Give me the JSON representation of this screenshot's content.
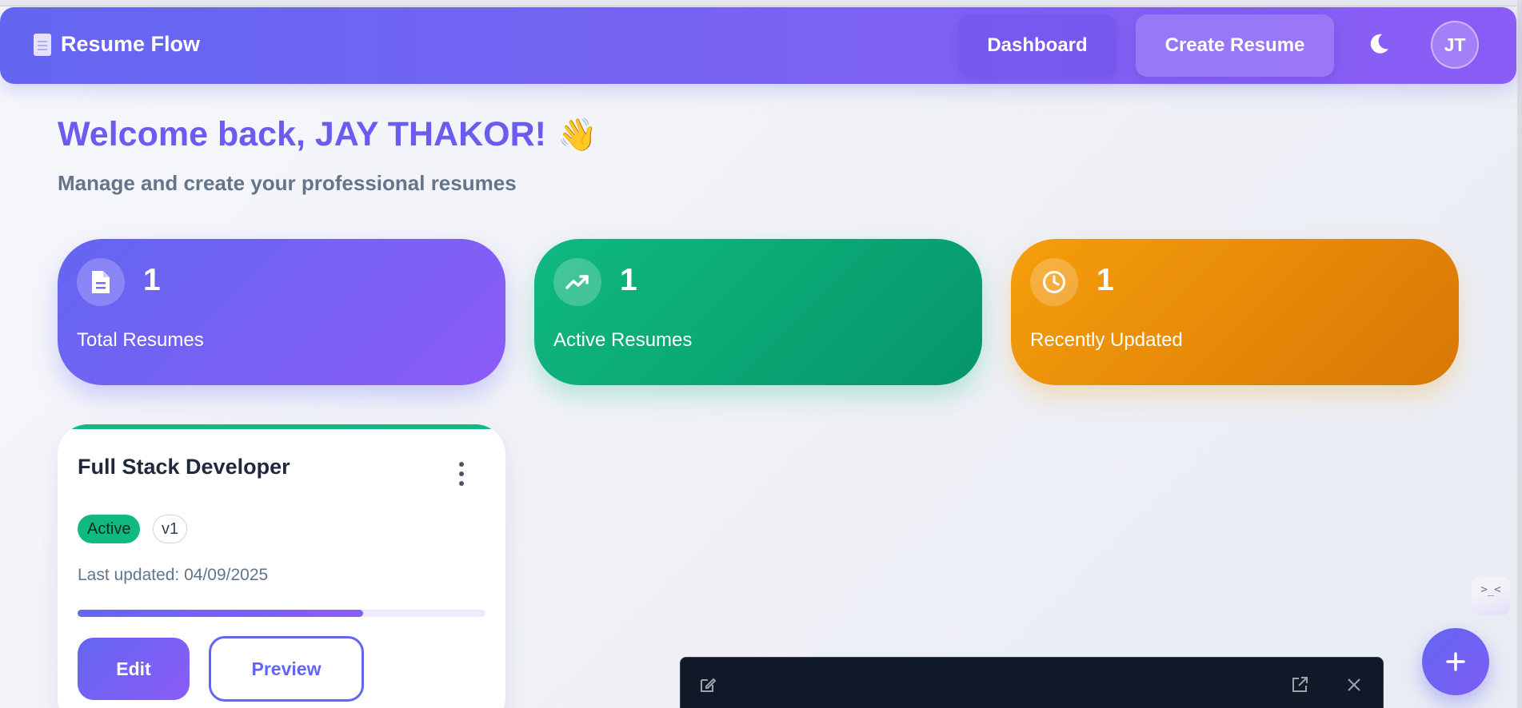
{
  "header": {
    "brand": "Resume Flow",
    "nav": {
      "dashboard": "Dashboard",
      "create": "Create Resume"
    },
    "avatar_initials": "JT"
  },
  "welcome": {
    "title": "Welcome back, JAY THAKOR!",
    "emoji": "👋",
    "subtitle": "Manage and create your professional resumes"
  },
  "stats": [
    {
      "value": "1",
      "label": "Total Resumes",
      "icon": "document-icon",
      "color": "#6366f1"
    },
    {
      "value": "1",
      "label": "Active Resumes",
      "icon": "trending-up-icon",
      "color": "#10b981"
    },
    {
      "value": "1",
      "label": "Recently Updated",
      "icon": "clock-icon",
      "color": "#f59e0b"
    }
  ],
  "resumes": [
    {
      "title": "Full Stack Developer",
      "status": "Active",
      "version": "v1",
      "updated": "Last updated: 04/09/2025",
      "progress_fraction": 0.7,
      "edit_label": "Edit",
      "preview_label": "Preview"
    }
  ],
  "side_widget": {
    "glyph": ">_<"
  },
  "colors": {
    "accent": "#6366f1",
    "accent2": "#8b5cf6",
    "success": "#10b981",
    "warning": "#f59e0b"
  }
}
